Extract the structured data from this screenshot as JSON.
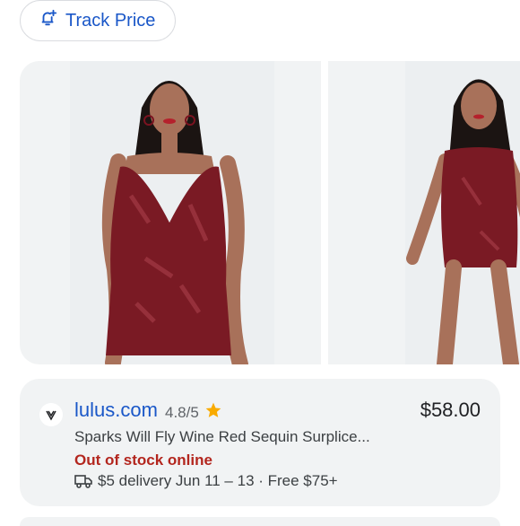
{
  "track_price": {
    "label": "Track Price",
    "icon": "bell-plus-icon"
  },
  "gallery": {
    "images": [
      {
        "alt": "wine red sequin romper front view"
      },
      {
        "alt": "wine red sequin romper angled view"
      }
    ]
  },
  "result": {
    "favicon_icon": "lulus-heart-icon",
    "domain": "lulus.com",
    "rating": "4.8/5",
    "star_icon": "star-icon",
    "price": "$58.00",
    "title": "Sparks Will Fly Wine Red Sequin Surplice...",
    "stock_status": "Out of stock online",
    "delivery": "$5 delivery Jun 11 – 13 · Free $75+",
    "delivery_icon": "truck-icon"
  },
  "colors": {
    "link_blue": "#1a57c8",
    "out_of_stock_red": "#b3261e",
    "star_yellow": "#f9ab00",
    "card_gray": "#f1f3f4"
  }
}
